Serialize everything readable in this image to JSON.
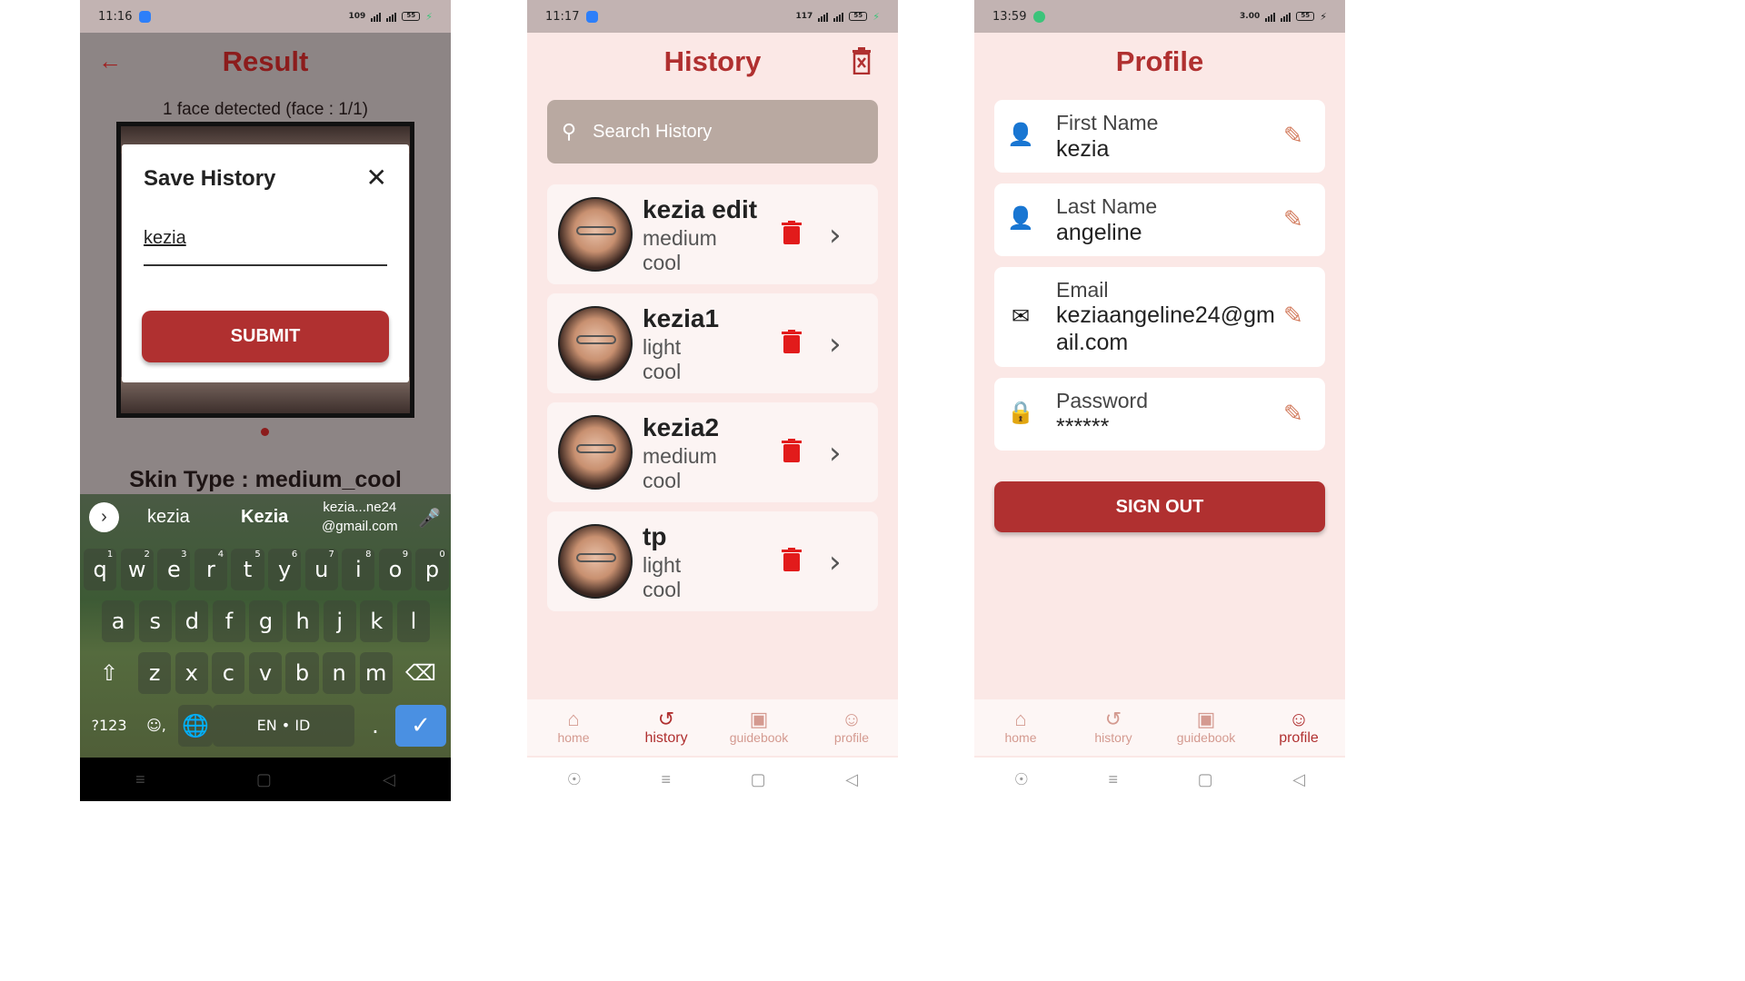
{
  "phone1": {
    "status": {
      "time": "11:16",
      "speed": "109"
    },
    "title": "Result",
    "faces_detected": "1 face detected (face : 1/1)",
    "skin_type": "Skin Type : medium_cool",
    "dialog": {
      "title": "Save History",
      "input_value": "kezia",
      "submit_label": "SUBMIT"
    },
    "keyboard": {
      "suggestions": [
        "kezia",
        "Kezia",
        "kezia...ne24\n@gmail.com"
      ],
      "row1": [
        "q",
        "w",
        "e",
        "r",
        "t",
        "y",
        "u",
        "i",
        "o",
        "p"
      ],
      "row1_nums": [
        "1",
        "2",
        "3",
        "4",
        "5",
        "6",
        "7",
        "8",
        "9",
        "0"
      ],
      "row2": [
        "a",
        "s",
        "d",
        "f",
        "g",
        "h",
        "j",
        "k",
        "l"
      ],
      "row3": [
        "z",
        "x",
        "c",
        "v",
        "b",
        "n",
        "m"
      ],
      "numbers_key": "?123",
      "space_label": "EN • ID",
      "period_key": "."
    }
  },
  "phone2": {
    "status": {
      "time": "11:17",
      "speed": "117"
    },
    "title": "History",
    "search_placeholder": "Search History",
    "items": [
      {
        "name": "kezia edit",
        "tone": "medium",
        "temp": "cool"
      },
      {
        "name": "kezia1",
        "tone": "light",
        "temp": "cool"
      },
      {
        "name": "kezia2",
        "tone": "medium",
        "temp": "cool"
      },
      {
        "name": "tp",
        "tone": "light",
        "temp": "cool"
      }
    ],
    "tabs": [
      "home",
      "history",
      "guidebook",
      "profile"
    ]
  },
  "phone3": {
    "status": {
      "time": "13:59",
      "speed": "3.00"
    },
    "title": "Profile",
    "fields": [
      {
        "label": "First Name",
        "value": "kezia"
      },
      {
        "label": "Last Name",
        "value": "angeline"
      },
      {
        "label": "Email",
        "value": "keziaangeline24@gm\nail.com"
      },
      {
        "label": "Password",
        "value": "******"
      }
    ],
    "signout_label": "SIGN OUT",
    "tabs": [
      "home",
      "history",
      "guidebook",
      "profile"
    ]
  },
  "colors": {
    "accent": "#b03030",
    "title_dark": "#8c1c1c",
    "bg_pink": "#fbe8e6",
    "delete_red": "#e21b1b",
    "edit_orange": "#d27a5c"
  },
  "icons": [
    "back-arrow-icon",
    "close-icon",
    "trash-icon",
    "search-icon",
    "delete-icon",
    "chevron-right-icon",
    "home-icon",
    "history-icon",
    "guidebook-icon",
    "profile-icon",
    "person-icon",
    "mail-icon",
    "lock-icon",
    "pencil-icon",
    "mic-icon",
    "globe-icon",
    "shift-icon",
    "backspace-icon",
    "check-icon"
  ]
}
